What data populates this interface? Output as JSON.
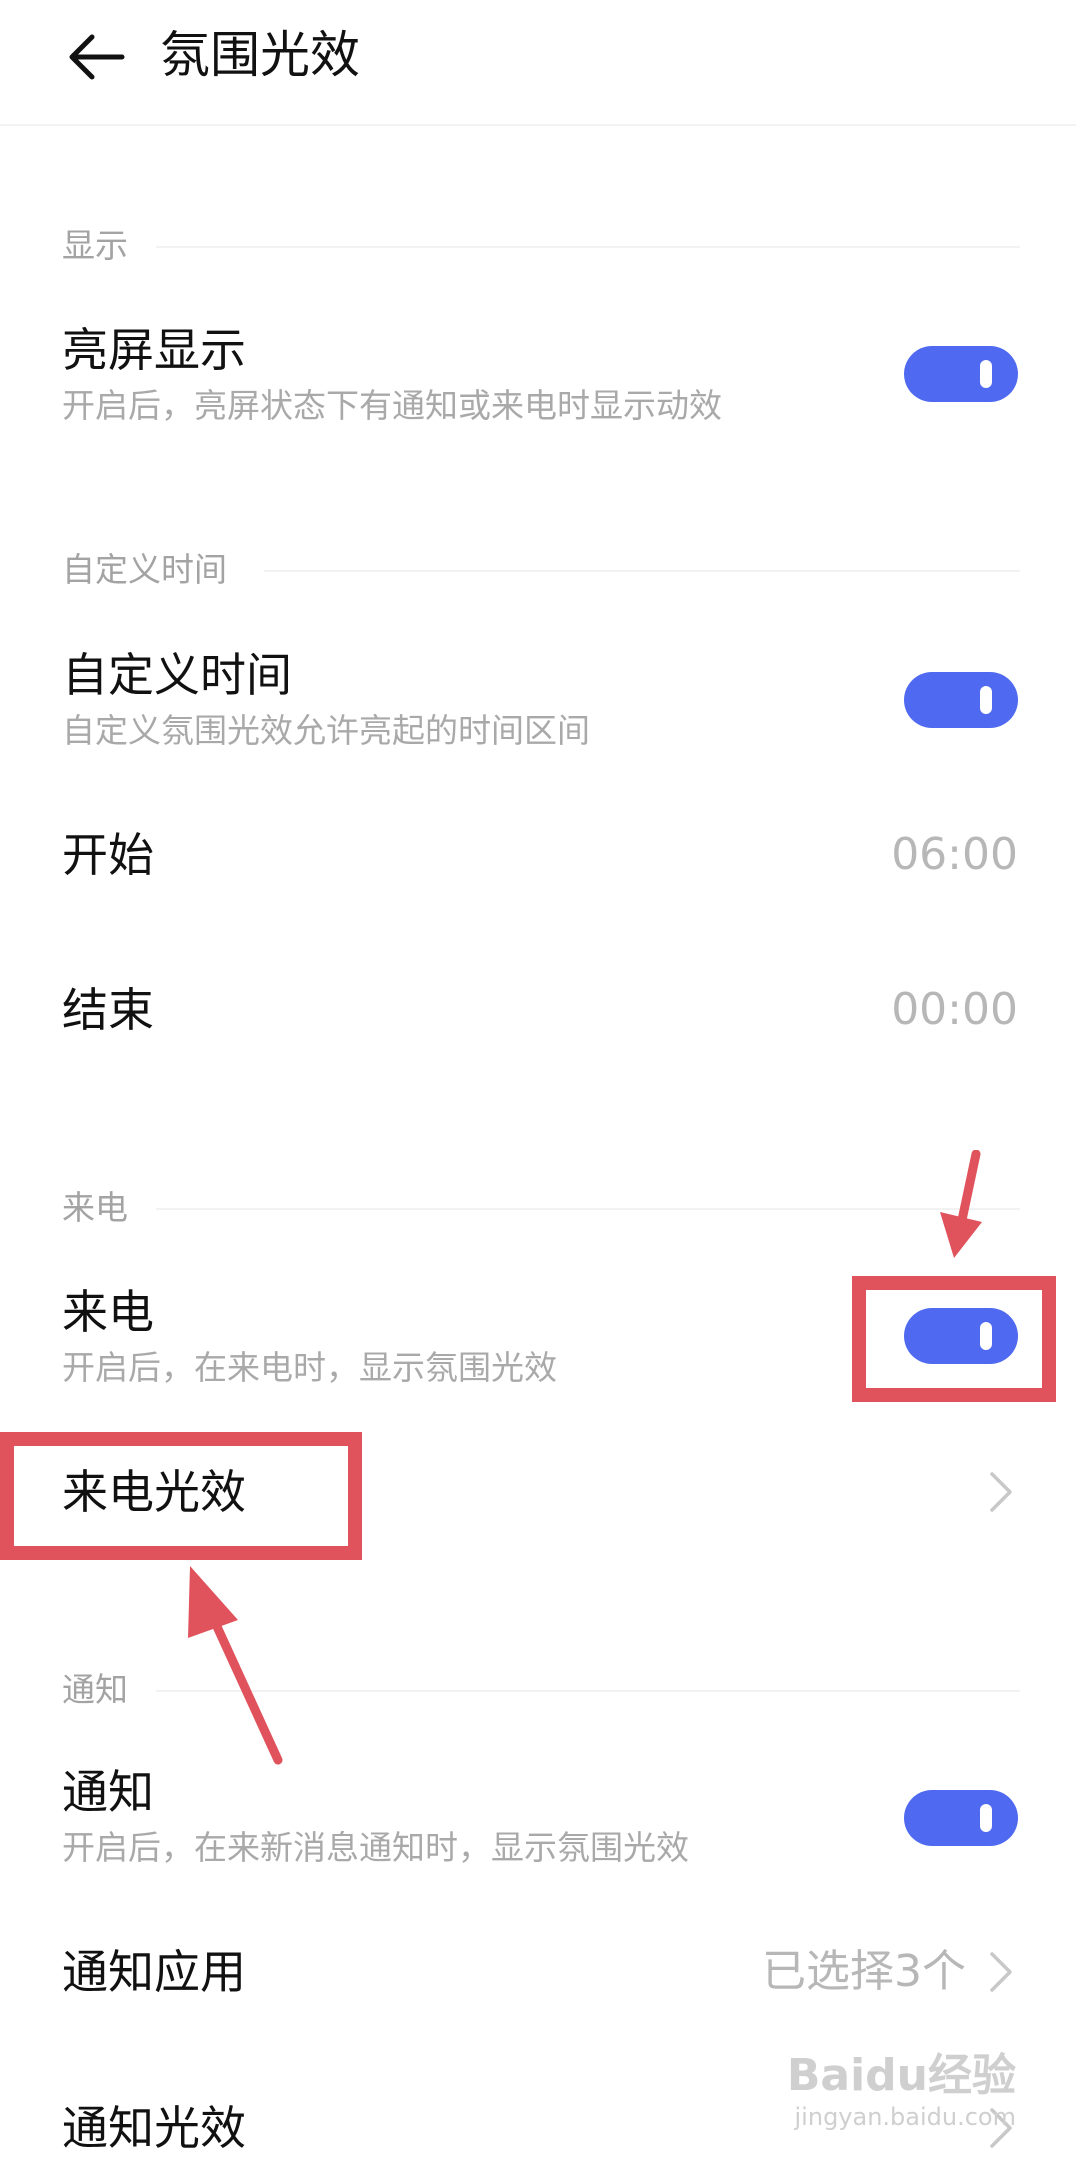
{
  "header": {
    "title": "氛围光效"
  },
  "sections": {
    "display": {
      "label": "显示"
    },
    "custom_time": {
      "label": "自定义时间"
    },
    "incoming_call": {
      "label": "来电"
    },
    "notification": {
      "label": "通知"
    }
  },
  "rows": {
    "screen_on_display": {
      "title": "亮屏显示",
      "subtitle": "开启后，亮屏状态下有通知或来电时显示动效",
      "toggle_on": true
    },
    "custom_time": {
      "title": "自定义时间",
      "subtitle": "自定义氛围光效允许亮起的时间区间",
      "toggle_on": true
    },
    "start": {
      "title": "开始",
      "value": "06:00"
    },
    "end": {
      "title": "结束",
      "value": "00:00"
    },
    "incoming_call": {
      "title": "来电",
      "subtitle": "开启后，在来电时，显示氛围光效",
      "toggle_on": true
    },
    "call_light_effect": {
      "title": "来电光效"
    },
    "notification": {
      "title": "通知",
      "subtitle": "开启后，在来新消息通知时，显示氛围光效",
      "toggle_on": true
    },
    "notification_apps": {
      "title": "通知应用",
      "value": "已选择3个"
    },
    "notification_light_effect": {
      "title": "通知光效"
    }
  },
  "colors": {
    "accent": "#4f6af0",
    "annotation": "#e0525c"
  },
  "watermark": {
    "logo": "Baidu经验",
    "url": "jingyan.baidu.com"
  }
}
